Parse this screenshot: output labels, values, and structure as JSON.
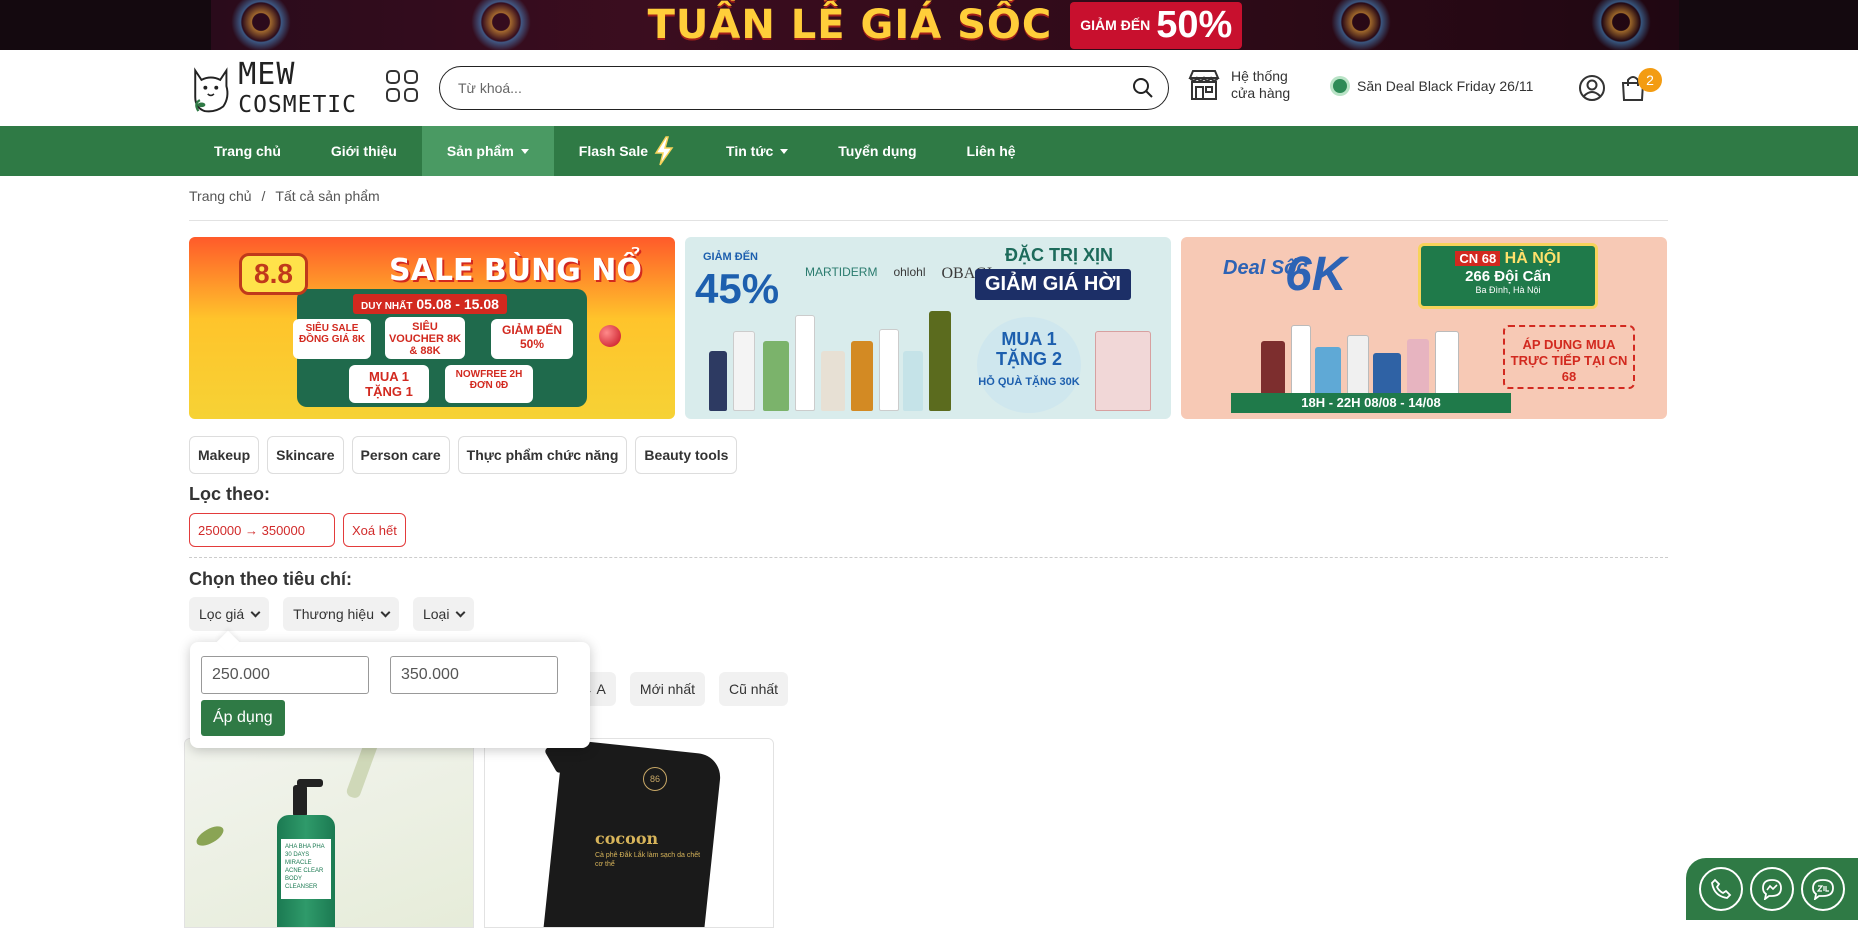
{
  "promo": {
    "title": "TUẦN LỄ GIÁ SỐC",
    "badge_small": "GIẢM ĐẾN",
    "badge_big": "50%"
  },
  "header": {
    "logo_line1": "MEW",
    "logo_line2": "COSMETIC",
    "search_placeholder": "Từ khoá...",
    "store_line1": "Hệ thống",
    "store_line2": "cửa hàng",
    "deal_text": "Săn Deal Black Friday 26/11",
    "cart_count": "2"
  },
  "nav": {
    "items": [
      {
        "label": "Trang chủ"
      },
      {
        "label": "Giới thiệu"
      },
      {
        "label": "Sản phẩm"
      },
      {
        "label": "Flash Sale"
      },
      {
        "label": "Tin tức"
      },
      {
        "label": "Tuyển dụng"
      },
      {
        "label": "Liên hệ"
      }
    ]
  },
  "breadcrumb": {
    "home": "Trang chủ",
    "sep": "/",
    "current": "Tất cả sản phẩm"
  },
  "banners": {
    "b1": {
      "badge": "8.8",
      "title": "SALE BÙNG NỔ",
      "date_prefix": "DUY NHẤT",
      "date": "05.08 - 15.08",
      "box1": "SIÊU SALE ĐỒNG GIÁ 8K",
      "box2": "SIÊU VOUCHER 8K & 88K",
      "box3": "GIẢM ĐẾN 50%",
      "box4": "MUA 1 TẶNG 1",
      "box5": "NOWFREE 2H ĐƠN 0Đ"
    },
    "b2": {
      "discount_label": "GIẢM ĐẾN",
      "discount": "45%",
      "brands": [
        "MARTIDERM",
        "ohlohl",
        "OBAGI"
      ],
      "title1": "ĐẶC TRỊ XỊN",
      "title2": "GIẢM GIÁ HỜI",
      "promo": "MUA 1 TẶNG 2",
      "promo_sub": "HỖ QUÀ TẶNG 30K"
    },
    "b3": {
      "deal": "Deal Sốc",
      "price": "6K",
      "card_cn": "CN 68",
      "card_city": "HÀ NỘI",
      "card_addr": "266 Đội Cấn",
      "card_sub": "Ba Đình, Hà Nội",
      "apply": "ÁP DỤNG MUA TRỰC TIẾP TẠI CN 68",
      "time": "18H - 22H   08/08 - 14/08"
    }
  },
  "categories": [
    "Makeup",
    "Skincare",
    "Person care",
    "Thực phẩm chức năng",
    "Beauty tools"
  ],
  "filter": {
    "label": "Lọc theo:",
    "active_filter": "250000 → 350000",
    "clear": "Xoá hết"
  },
  "criteria": {
    "label": "Chọn theo tiêu chí:",
    "options": [
      "Lọc giá",
      "Thương hiệu",
      "Loại"
    ]
  },
  "sorts": [
    "Z → A",
    "Mới nhất",
    "Cũ nhất"
  ],
  "price_popup": {
    "min": "250.000",
    "max": "350.000",
    "apply": "Áp dụng"
  },
  "products": [
    {
      "brand": "SOME BY MI",
      "name": "AHA BHA PHA 30 DAYS MIRACLE ACNE CLEAR BODY CLEANSER"
    },
    {
      "brand": "cocoon",
      "name": "Cà phê Đắk Lắk làm sạch da chết cơ thể"
    }
  ],
  "colors": {
    "primary": "#2f7a45",
    "accent": "#f39c12",
    "danger": "#d12b2b"
  }
}
